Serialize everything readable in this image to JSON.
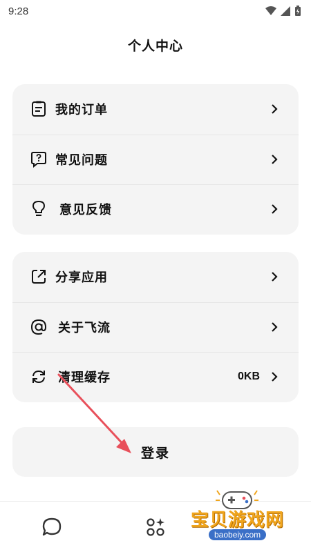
{
  "status_bar": {
    "time": "9:28"
  },
  "header": {
    "title": "个人中心"
  },
  "card1": {
    "items": [
      {
        "label": "我的订单",
        "icon": "clipboard-list-icon"
      },
      {
        "label": "常见问题",
        "icon": "question-bubble-icon"
      },
      {
        "label": "意见反馈",
        "icon": "lightbulb-icon"
      }
    ]
  },
  "card2": {
    "items": [
      {
        "label": "分享应用",
        "icon": "share-icon"
      },
      {
        "label": "关于飞流",
        "icon": "at-icon"
      },
      {
        "label": "清理缓存",
        "icon": "refresh-icon",
        "value": "0KB"
      }
    ]
  },
  "login": {
    "label": "登录"
  },
  "bottom_nav": {
    "items": [
      "chat-icon",
      "apps-icon"
    ]
  },
  "watermark": {
    "text": "宝贝游戏网",
    "url": "baobeiy.com"
  },
  "colors": {
    "card_bg": "#f4f4f4",
    "annotation_arrow": "#e8505b",
    "watermark": "#f0a51c"
  }
}
